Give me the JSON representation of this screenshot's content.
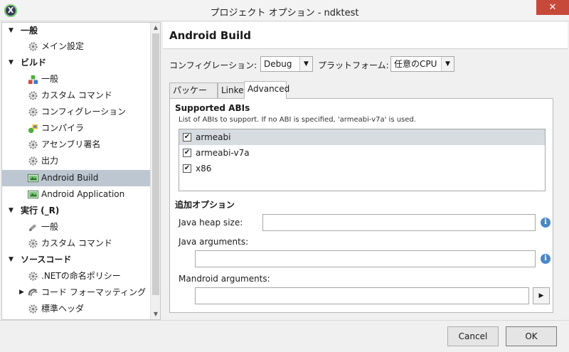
{
  "window": {
    "title": "プロジェクト オプション - ndktest",
    "close_glyph": "✕",
    "app_icon_glyph": "X"
  },
  "tree": {
    "groups": [
      {
        "label": "一般",
        "expanded": true
      },
      {
        "label": "ビルド",
        "expanded": true
      },
      {
        "label": "実行 (_R)",
        "expanded": true
      },
      {
        "label": "ソースコード",
        "expanded": true
      }
    ],
    "items": [
      {
        "label": "メイン設定",
        "icon": "gear-icon"
      },
      {
        "label": "一般",
        "icon": "build-general-icon"
      },
      {
        "label": "カスタム コマンド",
        "icon": "gear-icon"
      },
      {
        "label": "コンフィグレーション",
        "icon": "gear-icon"
      },
      {
        "label": "コンパイラ",
        "icon": "compiler-icon"
      },
      {
        "label": "アセンブリ署名",
        "icon": "gear-icon"
      },
      {
        "label": "出力",
        "icon": "gear-icon"
      },
      {
        "label": "Android Build",
        "icon": "android-icon"
      },
      {
        "label": "Android Application",
        "icon": "android-icon"
      },
      {
        "label": "一般",
        "icon": "run-icon"
      },
      {
        "label": "カスタム コマンド",
        "icon": "gear-icon"
      },
      {
        "label": ".NETの命名ポリシー",
        "icon": "gear-icon"
      },
      {
        "label": "コード フォーマッティング",
        "icon": "format-icon"
      },
      {
        "label": "標準ヘッダ",
        "icon": "gear-icon"
      }
    ],
    "selected": "Android Build"
  },
  "panel": {
    "title": "Android Build",
    "config_label": "コンフィグレーション:",
    "config_value": "Debug",
    "platform_label": "プラットフォーム:",
    "platform_value": "任意のCPU",
    "tabs": [
      {
        "label": "パッケージ",
        "active": false
      },
      {
        "label": "Linker",
        "active": false
      },
      {
        "label": "Advanced",
        "active": true
      }
    ],
    "abi_section": {
      "title": "Supported ABIs",
      "description": "List of ABIs to support. If no ABI is specified, 'armeabi-v7a' is used.",
      "items": [
        {
          "label": "armeabi",
          "checked": true
        },
        {
          "label": "armeabi-v7a",
          "checked": true
        },
        {
          "label": "x86",
          "checked": true
        }
      ]
    },
    "extra_section": {
      "title": "追加オプション",
      "java_heap_label": "Java heap size:",
      "java_heap_value": "",
      "java_args_label": "Java arguments:",
      "java_args_value": "",
      "mandroid_label": "Mandroid arguments:",
      "mandroid_value": ""
    }
  },
  "buttons": {
    "cancel": "Cancel",
    "ok": "OK"
  },
  "colors": {
    "selection": "#bcc7d2",
    "close": "#c7493a",
    "info": "#4a87c8"
  }
}
